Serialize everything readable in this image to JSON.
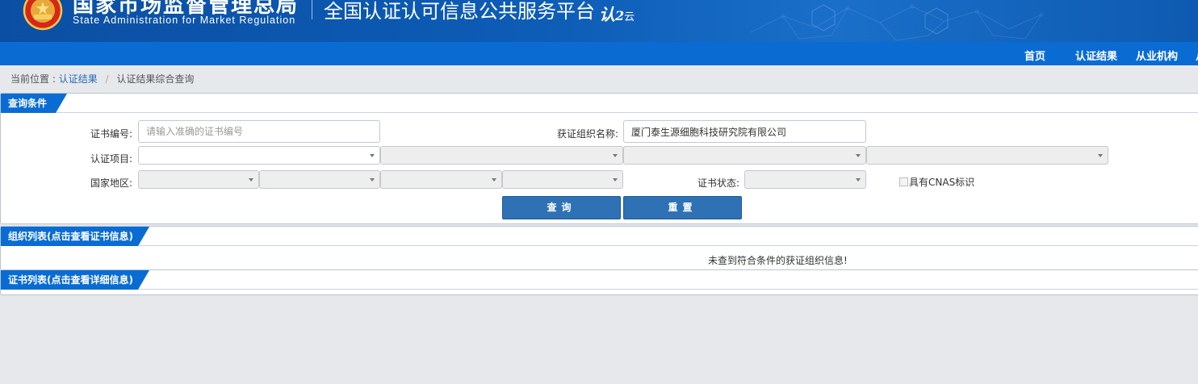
{
  "header": {
    "agency_cn": "国家市场监督管理总局",
    "agency_en": "State Administration  for  Market Regulation",
    "platform_title": "全国认证认可信息公共服务平台",
    "platform_logo_main": "认",
    "platform_logo_small": "云"
  },
  "nav": {
    "items": [
      {
        "label": "首页"
      },
      {
        "label": "认证结果"
      },
      {
        "label": "从业机构"
      },
      {
        "label": "从"
      }
    ]
  },
  "breadcrumb": {
    "prefix": "当前位置 :",
    "link": "认证结果",
    "separator": "/",
    "current": "认证结果综合查询"
  },
  "query_panel": {
    "title": "查询条件",
    "cert_no_label": "证书编号:",
    "cert_no_placeholder": "请输入准确的证书编号",
    "org_name_label": "获证组织名称:",
    "org_name_value": "厦门泰生源细胞科技研究院有限公司",
    "project_label": "认证项目:",
    "region_label": "国家地区:",
    "status_label": "证书状态:",
    "cnas_label": "具有CNAS标识",
    "search_button": "查询",
    "reset_button": "重置"
  },
  "org_panel": {
    "title": "组织列表(点击查看证书信息)",
    "empty_message": "未查到符合条件的获证组织信息!"
  },
  "cert_panel": {
    "title": "证书列表(点击查看详细信息)"
  },
  "colors": {
    "banner": "#0d5cb6",
    "navbar": "#0a6cd3",
    "tab": "#0a6cd3",
    "button": "#2f71b5",
    "page_bg": "#e6e8ec"
  }
}
